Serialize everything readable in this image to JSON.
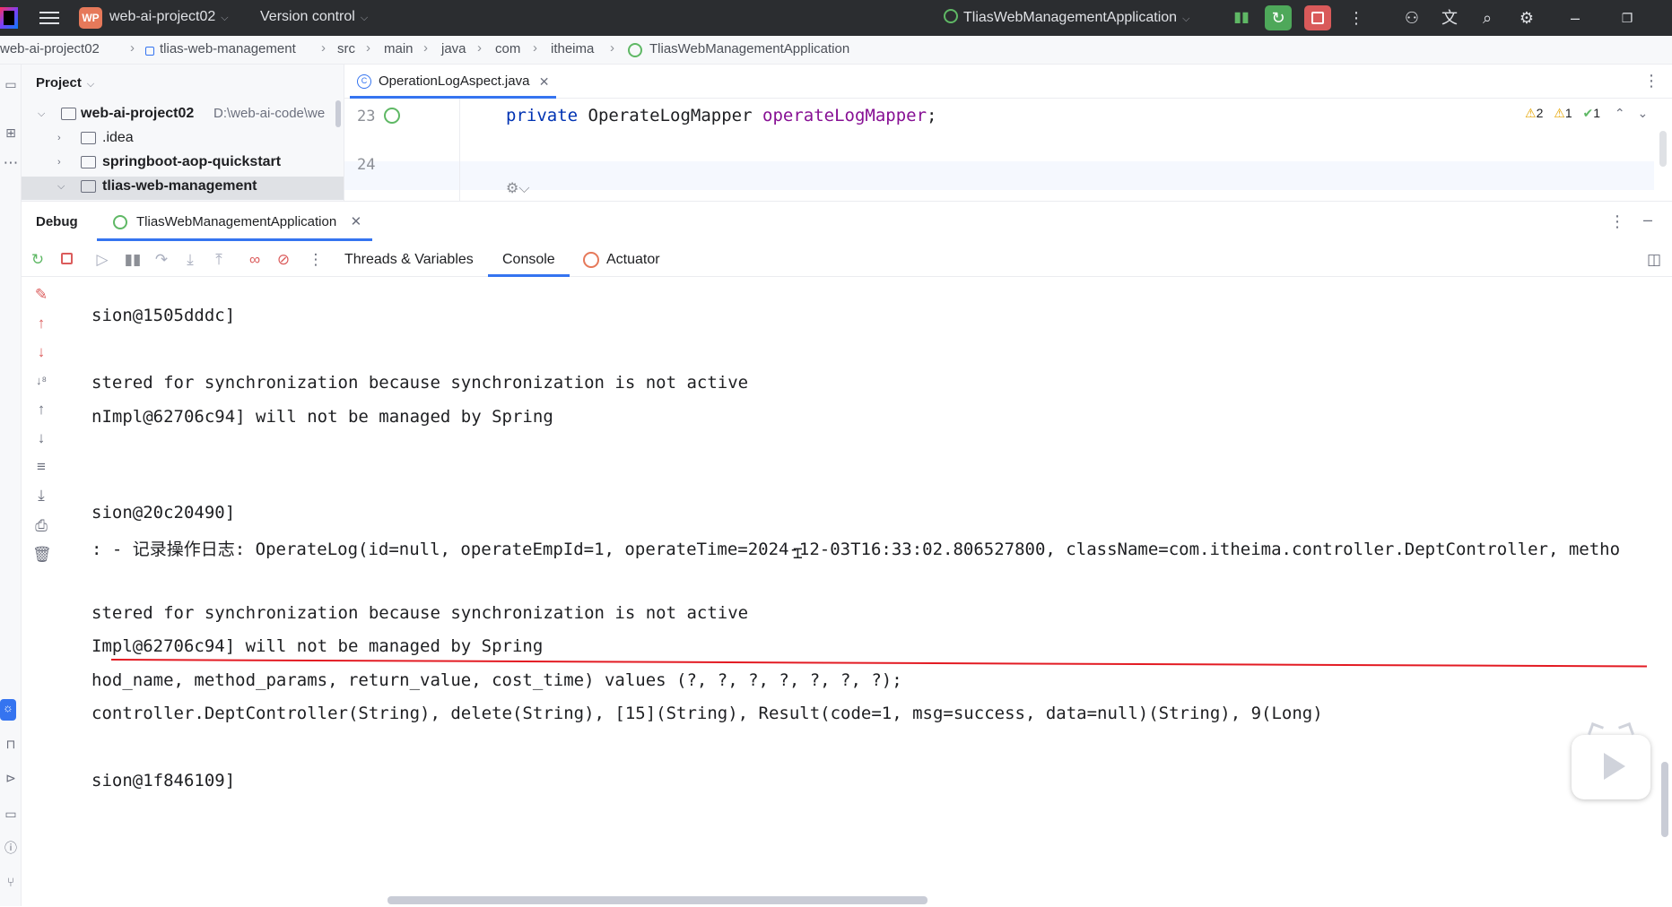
{
  "titlebar": {
    "project_badge": "WP",
    "project_name": "web-ai-project02",
    "version_control": "Version control",
    "run_config": "TliasWebManagementApplication"
  },
  "breadcrumb": [
    "web-ai-project02",
    "tlias-web-management",
    "src",
    "main",
    "java",
    "com",
    "itheima",
    "TliasWebManagementApplication"
  ],
  "project": {
    "title": "Project",
    "tree": [
      {
        "label": "web-ai-project02",
        "path": "D:\\web-ai-code\\we"
      },
      {
        "label": ".idea"
      },
      {
        "label": "springboot-aop-quickstart"
      },
      {
        "label": "tlias-web-management"
      }
    ]
  },
  "editor": {
    "tab": "OperationLogAspect.java",
    "line_numbers": [
      "23",
      "24"
    ],
    "code": {
      "keyword": "private",
      "type": "OperateLogMapper",
      "field": "operateLogMapper",
      "end": ";"
    },
    "inspections": {
      "warnings": "2",
      "weak": "1",
      "ok": "1"
    }
  },
  "debug": {
    "title": "Debug",
    "session": "TliasWebManagementApplication",
    "tabs": [
      "Threads & Variables",
      "Console",
      "Actuator"
    ]
  },
  "console": {
    "lines": [
      "sion@1505dddc]",
      "stered for synchronization because synchronization is not active",
      "nImpl@62706c94] will not be managed by Spring",
      "sion@20c20490]",
      ": - 记录操作日志: OperateLog(id=null, operateEmpId=1, operateTime=2024-12-03T16:33:02.806527800, className=com.itheima.controller.DeptController, metho",
      "stered for synchronization because synchronization is not active",
      "Impl@62706c94] will not be managed by Spring",
      "hod_name, method_params, return_value, cost_time) values (?, ?, ?, ?, ?, ?, ?);",
      "controller.DeptController(String), delete(String), [15](String), Result(code=1, msg=success, data=null)(String), 9(Long)",
      "sion@1f846109]"
    ]
  }
}
